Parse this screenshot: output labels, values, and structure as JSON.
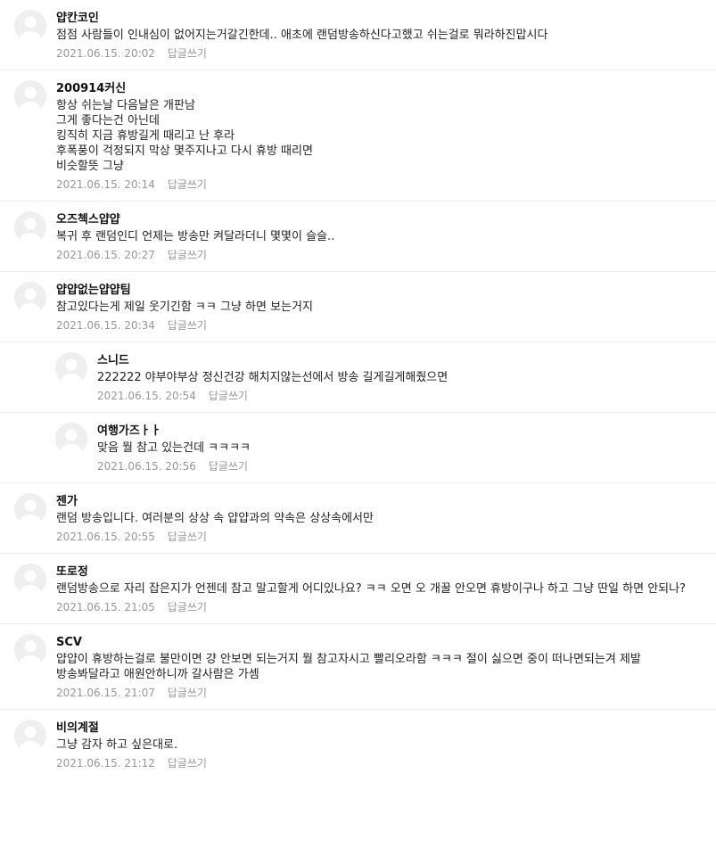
{
  "reply_label": "답글쓰기",
  "avatar_icon": "default-profile-icon",
  "comments": [
    {
      "nick": "얍칸코인",
      "text": "점점 사람들이 인내심이 없어지는거갈긴한데.. 애초에 랜덤방송하신다고했고 쉬는걸로 뭐라하진맙시다",
      "date": "2021.06.15. 20:02",
      "reply": false
    },
    {
      "nick": "200914커신",
      "text": "항상 쉬는날 다음날은 개판남\n그게 좋다는건 아닌데\n킹직히 지금 휴방길게 때리고 난 후라\n후폭풍이 걱정되지 막상 몇주지나고 다시 휴방 때리면\n비슷할뜻 그냥",
      "date": "2021.06.15. 20:14",
      "reply": false
    },
    {
      "nick": "오즈첵스얍얍",
      "text": "복귀 후 랜덤인디 언제는 방송만 켜달라더니 몇몇이 슬슬..",
      "date": "2021.06.15. 20:27",
      "reply": false
    },
    {
      "nick": "얍얍없는얍얍팀",
      "text": "참고있다는게 제일 웃기긴함 ㅋㅋ 그냥 하면 보는거지",
      "date": "2021.06.15. 20:34",
      "reply": false
    },
    {
      "nick": "스니드",
      "text": "222222 야부야부상 정신건강 해치지않는선에서 방송 길게길게해줬으면",
      "date": "2021.06.15. 20:54",
      "reply": true
    },
    {
      "nick": "여행가즈ㅏㅏ",
      "text": "맞음 뭘 참고 있는건데 ㅋㅋㅋㅋ",
      "date": "2021.06.15. 20:56",
      "reply": true
    },
    {
      "nick": "젠가",
      "text": "랜덤 방송입니다. 여러분의 상상 속 얍얍과의 약속은 상상속에서만",
      "date": "2021.06.15. 20:55",
      "reply": false
    },
    {
      "nick": "또로정",
      "text": "랜덤방송으로 자리 잡은지가 언젠데 참고 말고할게 어디있나요? ㅋㅋ 오면 오 개꿀 안오면 휴방이구나 하고 그냥 딴일 하면 안되나?",
      "date": "2021.06.15. 21:05",
      "reply": false
    },
    {
      "nick": "SCV",
      "text": "얍얍이 휴방하는걸로 불만이면 걍 안보면 되는거지 뭘 참고자시고 빨리오라함 ㅋㅋㅋ 절이 싫으면 중이 떠나면되는겨 제발 방송봐달라고 애원안하니까 갈사람은 가셈",
      "date": "2021.06.15. 21:07",
      "reply": false
    },
    {
      "nick": "비의계절",
      "text": "그냥 감자 하고 싶은대로.",
      "date": "2021.06.15. 21:12",
      "reply": false
    }
  ]
}
